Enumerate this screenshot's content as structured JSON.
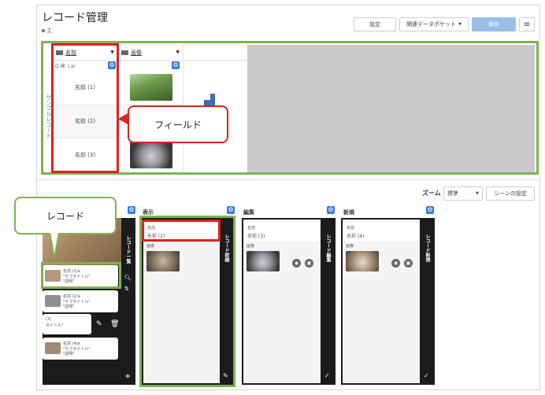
{
  "header": {
    "title": "レコード管理",
    "subtitle": "主",
    "settings_label": "設定",
    "related_label": "関連データポケット",
    "save_label": "保存",
    "menu_icon": "hamburger-icon"
  },
  "table": {
    "vertical_label": "サンプルレコード",
    "columns": [
      {
        "label": "名前",
        "icon": "text-field-icon"
      },
      {
        "label": "画像",
        "icon": "image-field-icon"
      }
    ],
    "search_text": "Q 検 ↓al",
    "rows": [
      {
        "name": "名前 (1)"
      },
      {
        "name": "名前 (2)"
      },
      {
        "name": "名前 (3)"
      }
    ]
  },
  "callouts": {
    "field": "フィールド",
    "record": "レコード"
  },
  "zoom": {
    "label": "ズーム",
    "value": "標準",
    "scene_settings": "シーンの設定"
  },
  "scenes": {
    "list": {
      "side_title": "レコード一覧",
      "items": [
        {
          "title": "名前 (1)a",
          "sub1": "\"サブタイトル\"",
          "sub2": "\"説明\""
        },
        {
          "title": "名前 (2)a",
          "sub1": "\"サブタイトル\"",
          "sub2": "\"説明\""
        },
        {
          "title": "(3)",
          "sub1": "タイトル\"",
          "sub2": ""
        },
        {
          "title": "名前 (4)a",
          "sub1": "\"サブタイトル\"",
          "sub2": "\"説明\""
        }
      ]
    },
    "display": {
      "label": "表示",
      "side_title": "レコード詳細",
      "field_label": "名前",
      "field_value": "名前 (2)",
      "image_label": "画像"
    },
    "edit": {
      "label": "編集",
      "side_title": "レコード編集",
      "field_label": "名前",
      "field_value": "名前 (3)",
      "image_label": "画像"
    },
    "new": {
      "label": "新規",
      "side_title": "レコード新規",
      "field_label": "名前",
      "field_value": "名前 (4)",
      "image_label": "画像"
    }
  },
  "colors": {
    "accent": "#3a7bd5",
    "green_highlight": "#7fb252",
    "red_highlight": "#d9231f"
  }
}
